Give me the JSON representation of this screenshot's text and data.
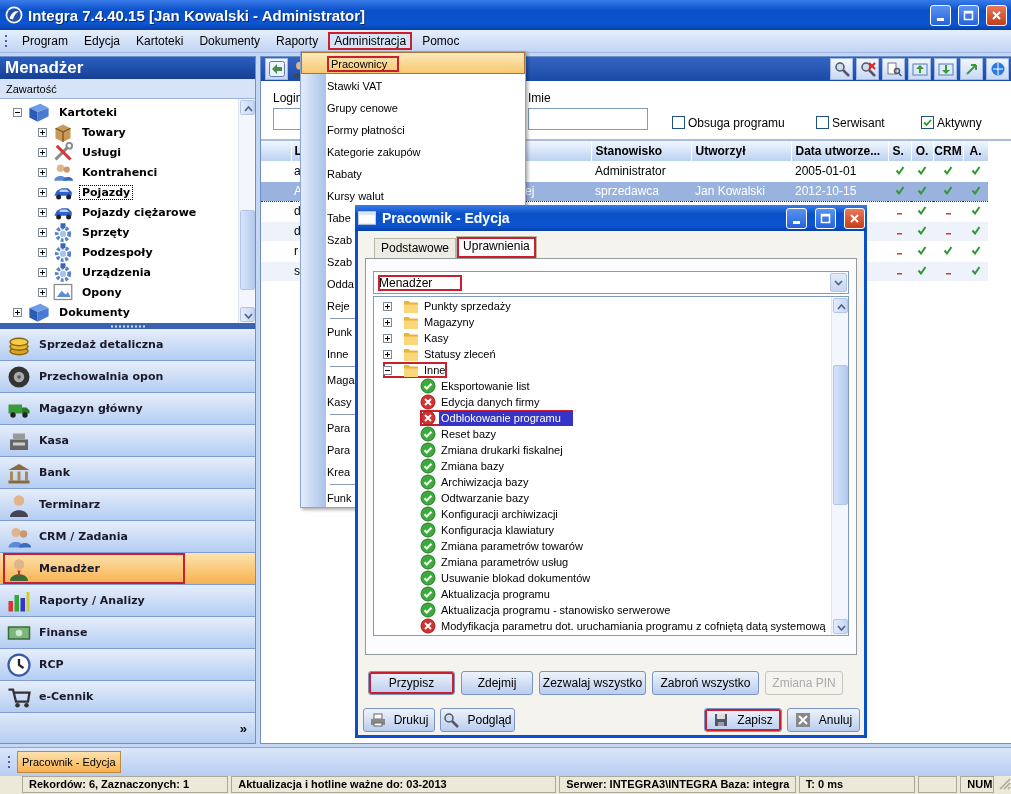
{
  "window": {
    "title": "Integra 7.4.40.15 [Jan Kowalski - Administrator]"
  },
  "menu_bar": [
    {
      "label": "Program",
      "open": false,
      "highlighted": false
    },
    {
      "label": "Edycja",
      "open": false,
      "highlighted": false
    },
    {
      "label": "Kartoteki",
      "open": false,
      "highlighted": false
    },
    {
      "label": "Dokumenty",
      "open": false,
      "highlighted": false
    },
    {
      "label": "Raporty",
      "open": false,
      "highlighted": false
    },
    {
      "label": "Administracja",
      "open": true,
      "highlighted": true
    },
    {
      "label": "Pomoc",
      "open": false,
      "highlighted": false
    }
  ],
  "sidebar": {
    "title": "Menadżer",
    "subtitle": "Zawartość",
    "tree": [
      {
        "label": "Kartoteki",
        "expanded": true,
        "focused": false,
        "children": [
          {
            "label": "Towary",
            "expanded": false,
            "focused": false
          },
          {
            "label": "Usługi",
            "expanded": false,
            "focused": false
          },
          {
            "label": "Kontrahenci",
            "expanded": false,
            "focused": false
          },
          {
            "label": "Pojazdy",
            "expanded": false,
            "focused": true
          },
          {
            "label": "Pojazdy ciężarowe",
            "expanded": false,
            "focused": false
          },
          {
            "label": "Sprzęty",
            "expanded": false,
            "focused": false
          },
          {
            "label": "Podzespoły",
            "expanded": false,
            "focused": false
          },
          {
            "label": "Urządzenia",
            "expanded": false,
            "focused": false
          },
          {
            "label": "Opony",
            "expanded": false,
            "focused": false
          }
        ]
      },
      {
        "label": "Dokumenty",
        "expanded": false,
        "focused": false
      }
    ],
    "modules": [
      {
        "label": "Sprzedaż detaliczna",
        "selected": false,
        "highlighted": false
      },
      {
        "label": "Przechowalnia opon",
        "selected": false,
        "highlighted": false
      },
      {
        "label": "Magazyn główny",
        "selected": false,
        "highlighted": false
      },
      {
        "label": "Kasa",
        "selected": false,
        "highlighted": false
      },
      {
        "label": "Bank",
        "selected": false,
        "highlighted": false
      },
      {
        "label": "Terminarz",
        "selected": false,
        "highlighted": false
      },
      {
        "label": "CRM / Zadania",
        "selected": false,
        "highlighted": false
      },
      {
        "label": "Menadżer",
        "selected": true,
        "highlighted": true
      },
      {
        "label": "Raporty / Analizy",
        "selected": false,
        "highlighted": false
      },
      {
        "label": "Finanse",
        "selected": false,
        "highlighted": false
      },
      {
        "label": "RCP",
        "selected": false,
        "highlighted": false
      },
      {
        "label": "e-Cennik",
        "selected": false,
        "highlighted": false
      }
    ],
    "more": "»"
  },
  "panel": {
    "filters": {
      "fields": [
        {
          "label": "Login"
        },
        {
          "label": "Imie"
        }
      ],
      "checkboxes": [
        {
          "label": "Obsuga programu",
          "checked": false
        },
        {
          "label": "Serwisant",
          "checked": false
        },
        {
          "label": "Aktywny",
          "checked": true
        }
      ]
    },
    "table": {
      "columns": [
        "L",
        "Stanowisko",
        "Utworzył",
        "Data utworze...",
        "S.",
        "O.",
        "CRM",
        "A."
      ],
      "rows": [
        {
          "column_1": "a",
          "stanowisko": "Administrator",
          "data_utworzenia": "2005-01-01",
          "flags": [
            true,
            true,
            true,
            true
          ],
          "selected": false
        },
        {
          "column_1": "A",
          "column_2": "ej",
          "stanowisko": "sprzedawca",
          "utworzyl": "Jan Kowalski",
          "data_utworzenia": "2012-10-15",
          "flags": [
            true,
            true,
            true,
            true
          ],
          "selected": true
        },
        {
          "column_1": "d",
          "flags": [
            false,
            true,
            false,
            true
          ],
          "selected": false
        },
        {
          "column_1": "d",
          "flags": [
            false,
            true,
            false,
            true
          ],
          "selected": false
        },
        {
          "column_1": "r",
          "flags": [
            false,
            true,
            true,
            true
          ],
          "selected": false
        },
        {
          "column_1": "s",
          "flags": [
            false,
            true,
            false,
            true
          ],
          "selected": false
        }
      ]
    }
  },
  "dropdown_menu": [
    {
      "kind": "item",
      "label": "Pracownicy",
      "selected": true,
      "highlighted": true
    },
    {
      "kind": "item",
      "label": "Stawki VAT",
      "selected": false,
      "highlighted": false
    },
    {
      "kind": "item",
      "label": "Grupy cenowe",
      "selected": false,
      "highlighted": false
    },
    {
      "kind": "item",
      "label": "Formy płatności",
      "selected": false,
      "highlighted": false
    },
    {
      "kind": "item",
      "label": "Kategorie zakupów",
      "selected": false,
      "highlighted": false
    },
    {
      "kind": "item",
      "label": "Rabaty",
      "selected": false,
      "highlighted": false
    },
    {
      "kind": "item",
      "label": "Kursy walut",
      "selected": false,
      "highlighted": false
    },
    {
      "kind": "item",
      "label": "Tabe",
      "selected": false,
      "highlighted": false
    },
    {
      "kind": "item",
      "label": "Szab",
      "selected": false,
      "highlighted": false
    },
    {
      "kind": "item",
      "label": "Szab",
      "selected": false,
      "highlighted": false
    },
    {
      "kind": "item",
      "label": "Odda",
      "selected": false,
      "highlighted": false
    },
    {
      "kind": "item",
      "label": "Reje",
      "selected": false,
      "highlighted": false
    },
    {
      "kind": "separator"
    },
    {
      "kind": "item",
      "label": "Punk",
      "selected": false,
      "highlighted": false
    },
    {
      "kind": "item",
      "label": "Inne",
      "selected": false,
      "highlighted": false
    },
    {
      "kind": "separator"
    },
    {
      "kind": "item",
      "label": "Maga",
      "selected": false,
      "highlighted": false
    },
    {
      "kind": "item",
      "label": "Kasy",
      "selected": false,
      "highlighted": false
    },
    {
      "kind": "separator"
    },
    {
      "kind": "item",
      "label": "Para",
      "selected": false,
      "highlighted": false
    },
    {
      "kind": "item",
      "label": "Para",
      "selected": false,
      "highlighted": false
    },
    {
      "kind": "item",
      "label": "Krea",
      "selected": false,
      "highlighted": false
    },
    {
      "kind": "separator"
    },
    {
      "kind": "item",
      "label": "Funk",
      "selected": false,
      "highlighted": false
    }
  ],
  "dialog": {
    "title": "Pracownik - Edycja",
    "tabs": [
      {
        "label": "Podstawowe",
        "selected": false,
        "highlighted": false
      },
      {
        "label": "Uprawnienia",
        "selected": true,
        "highlighted": true
      }
    ],
    "role": {
      "value": "Menadżer",
      "highlighted": true
    },
    "permissions": [
      {
        "kind": "folder",
        "label": "Punkty sprzedaży",
        "expanded": false,
        "highlighted": false
      },
      {
        "kind": "folder",
        "label": "Magazyny",
        "expanded": false,
        "highlighted": false
      },
      {
        "kind": "folder",
        "label": "Kasy",
        "expanded": false,
        "highlighted": false
      },
      {
        "kind": "folder",
        "label": "Statusy zleceń",
        "expanded": false,
        "highlighted": false
      },
      {
        "kind": "folder",
        "label": "Inne",
        "expanded": true,
        "highlighted": true,
        "children": [
          {
            "kind": "permission",
            "label": "Eksportowanie list",
            "allowed": true,
            "selected": false,
            "highlighted": false
          },
          {
            "kind": "permission",
            "label": "Edycja danych firmy",
            "allowed": false,
            "selected": false,
            "highlighted": false
          },
          {
            "kind": "permission",
            "label": "Odblokowanie programu",
            "allowed": false,
            "selected": true,
            "highlighted": true
          },
          {
            "kind": "permission",
            "label": "Reset bazy",
            "allowed": true,
            "selected": false,
            "highlighted": false
          },
          {
            "kind": "permission",
            "label": "Zmiana drukarki fiskalnej",
            "allowed": true,
            "selected": false,
            "highlighted": false
          },
          {
            "kind": "permission",
            "label": "Zmiana bazy",
            "allowed": true,
            "selected": false,
            "highlighted": false
          },
          {
            "kind": "permission",
            "label": "Archiwizacja bazy",
            "allowed": true,
            "selected": false,
            "highlighted": false
          },
          {
            "kind": "permission",
            "label": "Odtwarzanie bazy",
            "allowed": true,
            "selected": false,
            "highlighted": false
          },
          {
            "kind": "permission",
            "label": "Konfiguracji archiwizacji",
            "allowed": true,
            "selected": false,
            "highlighted": false
          },
          {
            "kind": "permission",
            "label": "Konfiguracja klawiatury",
            "allowed": true,
            "selected": false,
            "highlighted": false
          },
          {
            "kind": "permission",
            "label": "Zmiana parametrów towarów",
            "allowed": true,
            "selected": false,
            "highlighted": false
          },
          {
            "kind": "permission",
            "label": "Zmiana parametrów usług",
            "allowed": true,
            "selected": false,
            "highlighted": false
          },
          {
            "kind": "permission",
            "label": "Usuwanie blokad dokumentów",
            "allowed": true,
            "selected": false,
            "highlighted": false
          },
          {
            "kind": "permission",
            "label": "Aktualizacja programu",
            "allowed": true,
            "selected": false,
            "highlighted": false
          },
          {
            "kind": "permission",
            "label": "Aktualizacja programu - stanowisko serwerowe",
            "allowed": true,
            "selected": false,
            "highlighted": false
          },
          {
            "kind": "permission",
            "label": "Modyfikacja parametru dot. uruchamiania programu z cofniętą datą systemową",
            "allowed": false,
            "selected": false,
            "highlighted": false
          }
        ]
      }
    ],
    "action_buttons": [
      {
        "label": "Przypisz",
        "disabled": false,
        "highlighted": true
      },
      {
        "label": "Zdejmij",
        "disabled": false,
        "highlighted": false
      },
      {
        "label": "Zezwalaj wszystko",
        "disabled": false,
        "highlighted": false
      },
      {
        "label": "Zabroń wszystko",
        "disabled": false,
        "highlighted": false
      },
      {
        "label": "Zmiana PIN",
        "disabled": true,
        "highlighted": false
      }
    ],
    "footer_buttons": [
      {
        "label": "Drukuj",
        "highlighted": false
      },
      {
        "label": "Podgląd",
        "highlighted": false
      },
      {
        "label": "Zapisz",
        "highlighted": true
      },
      {
        "label": "Anuluj",
        "highlighted": false
      }
    ]
  },
  "taskbar": [
    {
      "label": "Pracownik - Edycja",
      "selected": true
    }
  ],
  "status_bar": [
    "Rekordów: 6, Zaznaczonych: 1",
    "Aktualizacja i hotline ważne do: 03-2013",
    "Serwer: INTEGRA3\\INTEGRA Baza: integra",
    "T: 0 ms",
    "NUM"
  ]
}
